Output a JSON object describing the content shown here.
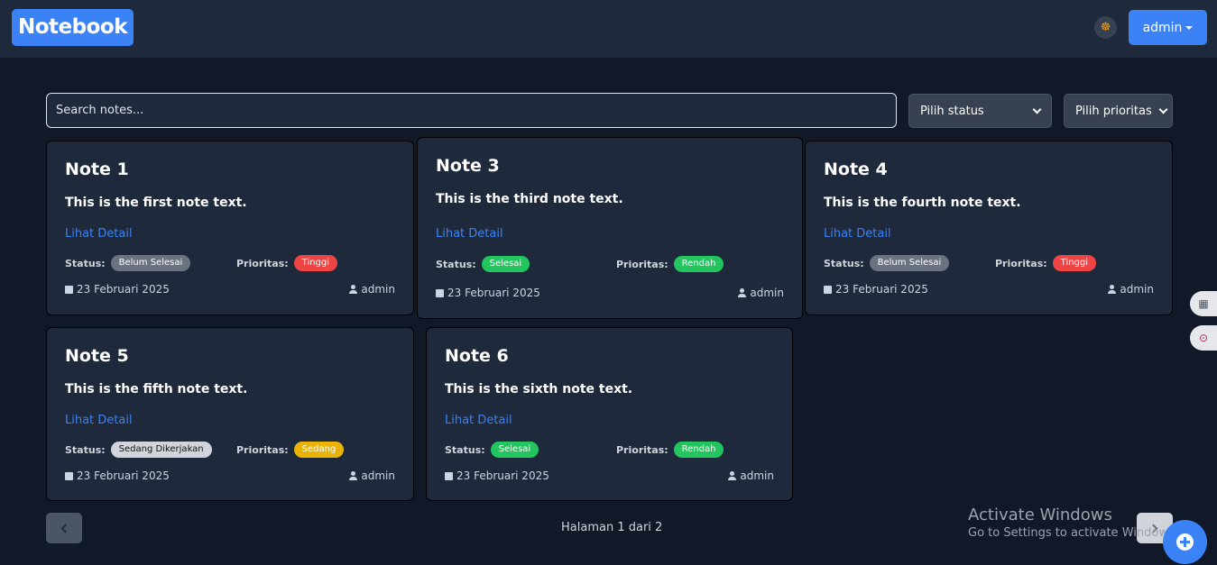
{
  "header": {
    "logo": "Notebook",
    "theme_icon": "☸",
    "user_label": "admin"
  },
  "filters": {
    "search_placeholder": "Search notes...",
    "status_label": "Pilih status",
    "priority_label": "Pilih prioritas"
  },
  "labels": {
    "detail": "Lihat Detail",
    "status": "Status:",
    "priority": "Prioritas:"
  },
  "notes": [
    {
      "title": "Note 1",
      "text": "This is the first note text.",
      "status": "Belum Selesai",
      "status_color": "#6b7280",
      "priority": "Tinggi",
      "priority_color": "#ef4444",
      "date": "23 Februari 2025",
      "author": "admin"
    },
    {
      "title": "Note 3",
      "text": "This is the third note text.",
      "status": "Selesai",
      "status_color": "#22c55e",
      "priority": "Rendah",
      "priority_color": "#22c55e",
      "date": "23 Februari 2025",
      "author": "admin"
    },
    {
      "title": "Note 4",
      "text": "This is the fourth note text.",
      "status": "Belum Selesai",
      "status_color": "#6b7280",
      "priority": "Tinggi",
      "priority_color": "#ef4444",
      "date": "23 Februari 2025",
      "author": "admin"
    },
    {
      "title": "Note 5",
      "text": "This is the fifth note text.",
      "status": "Sedang Dikerjakan",
      "status_color": "#d1d5db",
      "priority": "Sedang",
      "priority_color": "#eab308",
      "date": "23 Februari 2025",
      "author": "admin"
    },
    {
      "title": "Note 6",
      "text": "This is the sixth note text.",
      "status": "Selesai",
      "status_color": "#22c55e",
      "priority": "Rendah",
      "priority_color": "#22c55e",
      "date": "23 Februari 2025",
      "author": "admin"
    }
  ],
  "pagination": {
    "info": "Halaman 1 dari 2"
  },
  "watermark": {
    "line1": "Activate Windows",
    "line2": "Go to Settings to activate Windows."
  },
  "colors": {
    "accent": "#3b82f6",
    "background": "#111827",
    "card": "#1e293b"
  }
}
